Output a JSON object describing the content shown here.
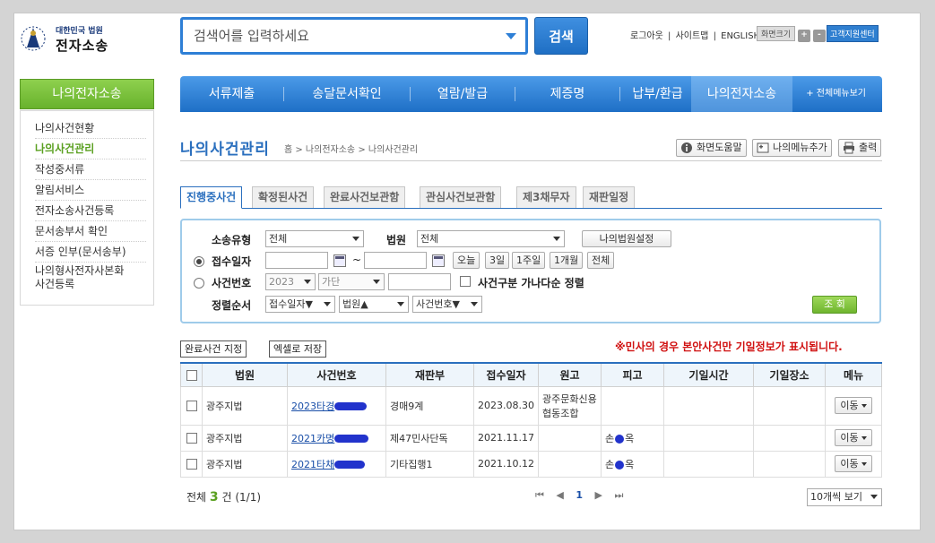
{
  "logo": {
    "line1": "대한민국 법원",
    "line2": "전자소송"
  },
  "search": {
    "placeholder": "검색어를 입력하세요",
    "button": "검색"
  },
  "util": {
    "logout": "로그아웃",
    "sitemap": "사이트맵",
    "english": "ENGLISH",
    "sep": "|",
    "fontsize_label": "화면크기",
    "plus": "+",
    "minus": "-",
    "helpdesk": "고객지원센터"
  },
  "left_nav": {
    "title": "나의전자소송",
    "items": [
      {
        "label": "나의사건현황"
      },
      {
        "label": "나의사건관리"
      },
      {
        "label": "작성중서류"
      },
      {
        "label": "알림서비스"
      },
      {
        "label": "전자소송사건등록"
      },
      {
        "label": "문서송부서 확인"
      },
      {
        "label": "서증 인부(문서송부)"
      },
      {
        "label": "나의형사전자사본화"
      },
      {
        "label": "사건등록"
      }
    ]
  },
  "top_menu": {
    "items": [
      {
        "label": "서류제출"
      },
      {
        "label": "송달문서확인"
      },
      {
        "label": "열람/발급"
      },
      {
        "label": "제증명"
      },
      {
        "label": "납부/환급"
      },
      {
        "label": "나의전자소송"
      }
    ],
    "all": "+ 전체메뉴보기"
  },
  "page": {
    "title": "나의사건관리",
    "breadcrumb": "홈 > 나의전자소송 > 나의사건관리",
    "help": "화면도움말",
    "add_menu": "나의메뉴추가",
    "print": "출력"
  },
  "tabs": [
    {
      "label": "진행중사건"
    },
    {
      "label": "확정된사건"
    },
    {
      "label": "완료사건보관함"
    },
    {
      "label": "관심사건보관함"
    },
    {
      "label": "제3채무자"
    },
    {
      "label": "재판일정"
    }
  ],
  "filter": {
    "type_label": "소송유형",
    "type_value": "전체",
    "court_label": "법원",
    "court_value": "전체",
    "my_court_btn": "나의법원설정",
    "date_label": "접수일자",
    "tilde": "~",
    "quick": [
      "오늘",
      "3일",
      "1주일",
      "1개월",
      "전체"
    ],
    "caseno_label": "사건번호",
    "year": "2023",
    "gubun": "가단",
    "sort_check_label": "사건구분 가나다순 정렬",
    "order_label": "정렬순서",
    "order1": "접수일자▼",
    "order2": "법원▲",
    "order3": "사건번호▼",
    "search_btn": "조 회"
  },
  "actions": {
    "complete": "완료사건 지정",
    "excel": "엑셀로 저장",
    "notice": "※민사의 경우 본안사건만 기일정보가 표시됩니다."
  },
  "table": {
    "headers": [
      "",
      "법원",
      "사건번호",
      "재판부",
      "접수일자",
      "원고",
      "피고",
      "기일시간",
      "기일장소",
      "메뉴"
    ],
    "rows": [
      {
        "court": "광주지법",
        "case_no": "2023타경",
        "division": "경매9계",
        "date": "2023.08.30",
        "plaintiff": "광주문화신용협동조합",
        "defendant_a": "",
        "defendant_b": "",
        "time": "",
        "place": "",
        "menu": "이동"
      },
      {
        "court": "광주지법",
        "case_no": "2021카명",
        "division": "제47민사단독",
        "date": "2021.11.17",
        "plaintiff": "",
        "defendant_a": "손",
        "defendant_b": "옥",
        "time": "",
        "place": "",
        "menu": "이동"
      },
      {
        "court": "광주지법",
        "case_no": "2021타채",
        "division": "기타집행1",
        "date": "2021.10.12",
        "plaintiff": "",
        "defendant_a": "손",
        "defendant_b": "옥",
        "time": "",
        "place": "",
        "menu": "이동"
      }
    ]
  },
  "footer": {
    "total_prefix": "전체",
    "total_count": "3",
    "total_suffix": "건 (1/1)",
    "pager_first": "⏮",
    "pager_prev": "◀",
    "page": "1",
    "pager_next": "▶",
    "pager_last": "⏭",
    "per_page": "10개씩 보기"
  }
}
